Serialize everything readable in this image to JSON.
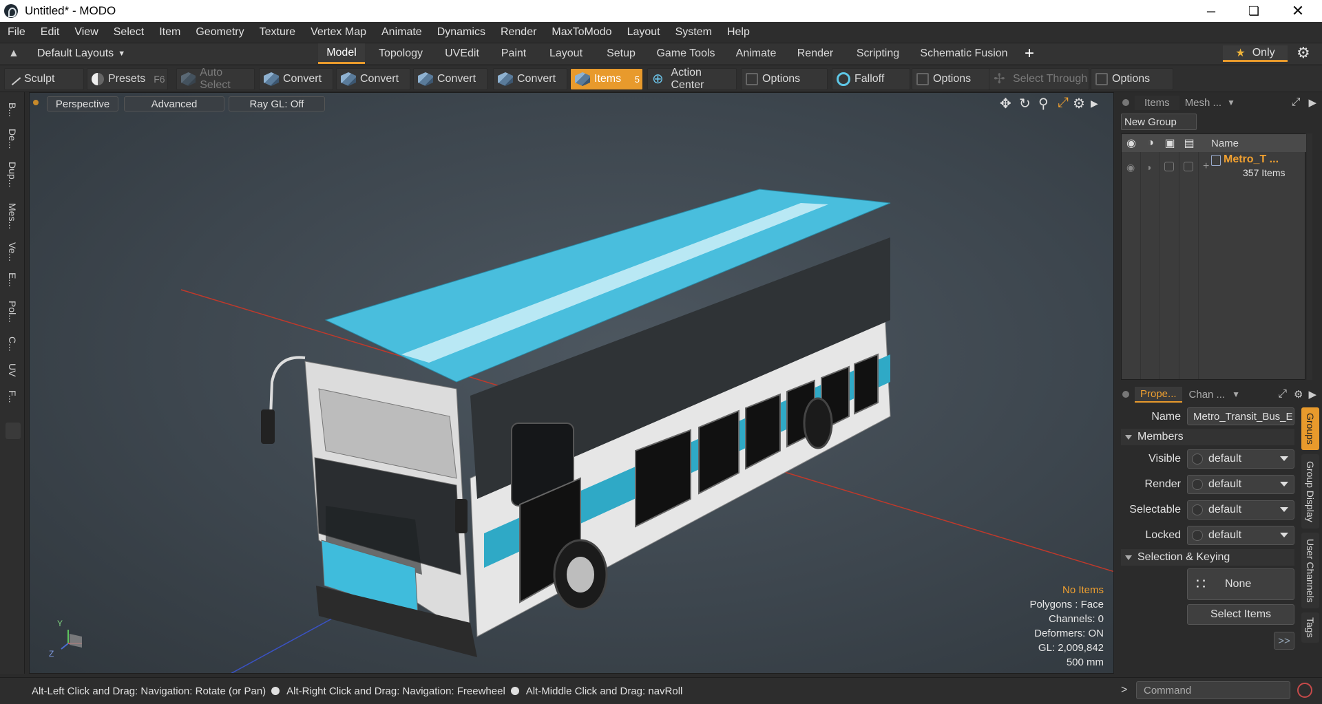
{
  "window": {
    "title": "Untitled* - MODO"
  },
  "menu": [
    "File",
    "Edit",
    "View",
    "Select",
    "Item",
    "Geometry",
    "Texture",
    "Vertex Map",
    "Animate",
    "Dynamics",
    "Render",
    "MaxToModo",
    "Layout",
    "System",
    "Help"
  ],
  "layout": {
    "selector": "Default Layouts",
    "tabs": [
      "Model",
      "Topology",
      "UVEdit",
      "Paint",
      "Layout",
      "Setup",
      "Game Tools",
      "Animate",
      "Render",
      "Scripting",
      "Schematic Fusion"
    ],
    "active_tab": "Model",
    "only_label": "Only"
  },
  "toolbar": {
    "sculpt": "Sculpt",
    "presets": "Presets",
    "presets_key": "F6",
    "auto_select": "Auto Select",
    "convert": "Convert",
    "items": "Items",
    "items_key": "5",
    "action_center": "Action Center",
    "options": "Options",
    "falloff": "Falloff",
    "select_through": "Select Through"
  },
  "leftstrip": [
    "B...",
    "De...",
    "Dup...",
    "Mes...",
    "Ve...",
    "E...",
    "Pol...",
    "C...",
    "UV",
    "F..."
  ],
  "viewport": {
    "view": "Perspective",
    "shading": "Advanced",
    "raygl": "Ray GL: Off",
    "axis_y": "Y",
    "axis_z": "Z",
    "info": {
      "selection": "No Items",
      "polygons": "Polygons : Face",
      "channels": "Channels: 0",
      "deformers": "Deformers: ON",
      "gl": "GL: 2,009,842",
      "scale": "500 mm"
    }
  },
  "items_panel": {
    "tabs": [
      "Items",
      "Mesh ..."
    ],
    "new_group": "New Group",
    "col_name": "Name",
    "group_name": "Metro_T ...",
    "group_count": "357 Items"
  },
  "properties": {
    "tabs": [
      "Prope...",
      "Chan ..."
    ],
    "name_label": "Name",
    "name_value": "Metro_Transit_Bus_E",
    "members": "Members",
    "visible_label": "Visible",
    "render_label": "Render",
    "selectable_label": "Selectable",
    "locked_label": "Locked",
    "default_value": "default",
    "selection_keying": "Selection & Keying",
    "none_label": "None",
    "select_items": "Select Items",
    "more": ">>",
    "side_tabs": [
      "Groups",
      "Group Display",
      "User Channels",
      "Tags"
    ]
  },
  "status": {
    "hint1": "Alt-Left Click and Drag: Navigation: Rotate (or Pan)",
    "hint2": "Alt-Right Click and Drag: Navigation: Freewheel",
    "hint3": "Alt-Middle Click and Drag: navRoll",
    "command_placeholder": "Command",
    "prompt": ">"
  },
  "colors": {
    "accent": "#e89a2c",
    "bus_blue": "#3fb9d8",
    "bus_body": "#e9e9e9"
  }
}
